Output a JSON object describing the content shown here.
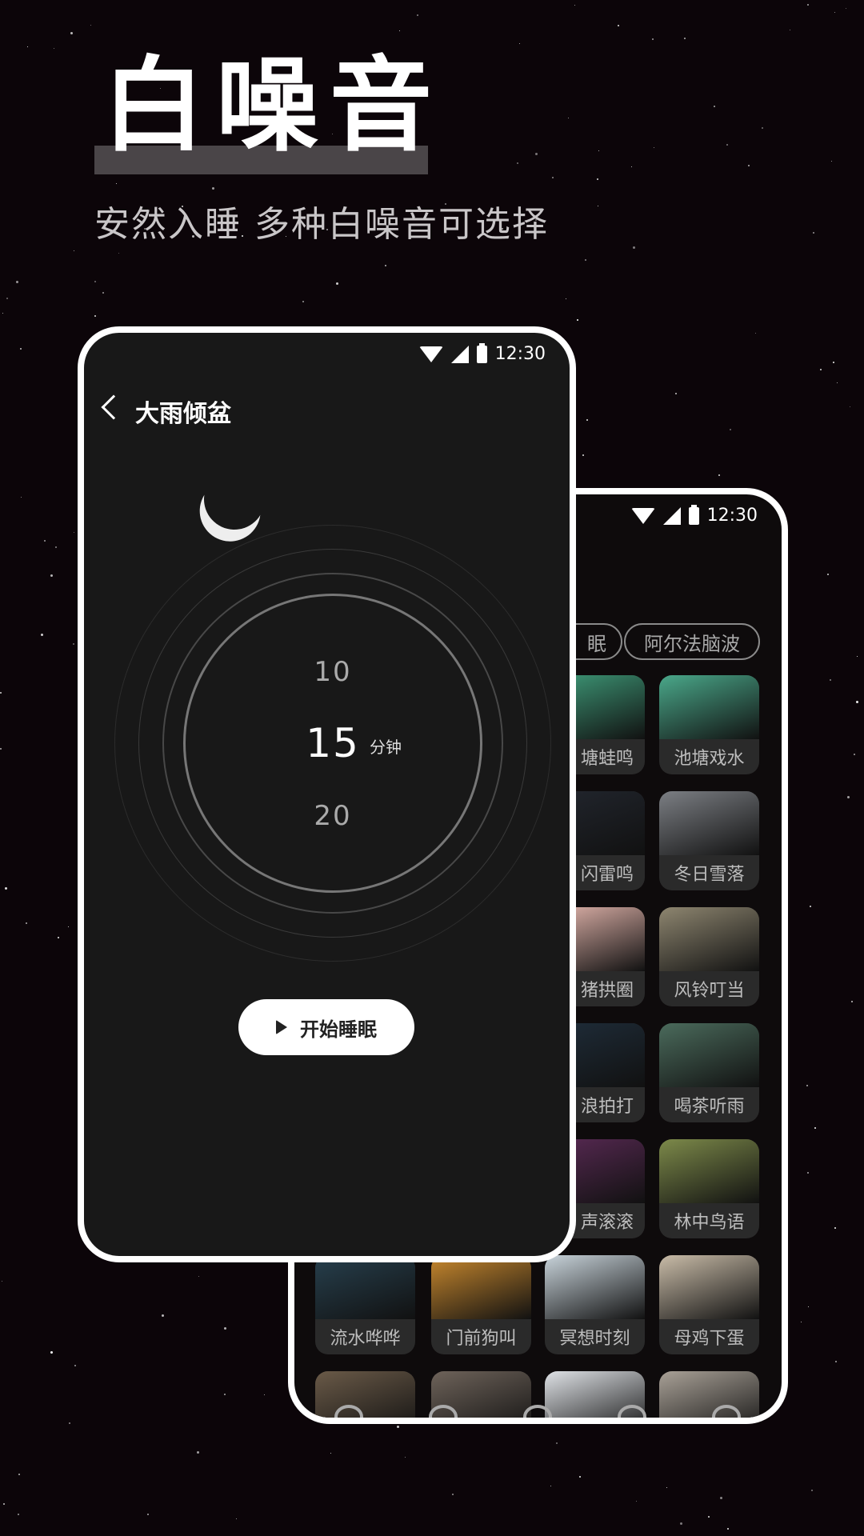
{
  "hero": {
    "title": "白噪音",
    "subtitle": "安然入睡 多种白噪音可选择"
  },
  "status": {
    "time": "12:30"
  },
  "back_screen": {
    "chips": [
      "眠",
      "阿尔法脑波"
    ],
    "rows": [
      [
        {
          "label": "",
          "color": "#1c1c1c"
        },
        {
          "label": "",
          "color": "#1c1c1c"
        },
        {
          "label": "塘蛙鸣",
          "color": "#3f9c7a",
          "partial": true
        },
        {
          "label": "池塘戏水",
          "color": "#4aa88a"
        }
      ],
      [
        {
          "label": "",
          "color": "#1c1c1c"
        },
        {
          "label": "",
          "color": "#1c1c1c"
        },
        {
          "label": "闪雷鸣",
          "color": "#22262e",
          "partial": true
        },
        {
          "label": "冬日雪落",
          "color": "#7c7f84"
        }
      ],
      [
        {
          "label": "",
          "color": "#1c1c1c"
        },
        {
          "label": "",
          "color": "#1c1c1c"
        },
        {
          "label": "猪拱圈",
          "color": "#e5b7ae",
          "partial": true
        },
        {
          "label": "风铃叮当",
          "color": "#8e8670"
        }
      ],
      [
        {
          "label": "",
          "color": "#1c1c1c"
        },
        {
          "label": "",
          "color": "#1c1c1c"
        },
        {
          "label": "浪拍打",
          "color": "#1f2d3a",
          "partial": true
        },
        {
          "label": "喝茶听雨",
          "color": "#4b6b5c"
        }
      ],
      [
        {
          "label": "",
          "color": "#1c1c1c"
        },
        {
          "label": "",
          "color": "#1c1c1c"
        },
        {
          "label": "声滚滚",
          "color": "#5a2a55",
          "partial": true
        },
        {
          "label": "林中鸟语",
          "color": "#7d8a4a"
        }
      ],
      [
        {
          "label": "流水哗哗",
          "color": "#27404e"
        },
        {
          "label": "门前狗叫",
          "color": "#c9892e"
        },
        {
          "label": "冥想时刻",
          "color": "#c8d3da"
        },
        {
          "label": "母鸡下蛋",
          "color": "#c9bca8"
        }
      ],
      [
        {
          "label": "",
          "color": "#6a5a48"
        },
        {
          "label": "",
          "color": "#6e635a"
        },
        {
          "label": "",
          "color": "#dfe2e6"
        },
        {
          "label": "",
          "color": "#a9a197"
        }
      ]
    ],
    "nav_icons": [
      "moon-icon",
      "beads-icon",
      "lotus-icon",
      "bone-icon",
      "face-icon"
    ]
  },
  "front_screen": {
    "title": "大雨倾盆",
    "picker": {
      "prev": "10",
      "current": "15",
      "next": "20",
      "unit": "分钟"
    },
    "start_button": "开始睡眠"
  }
}
